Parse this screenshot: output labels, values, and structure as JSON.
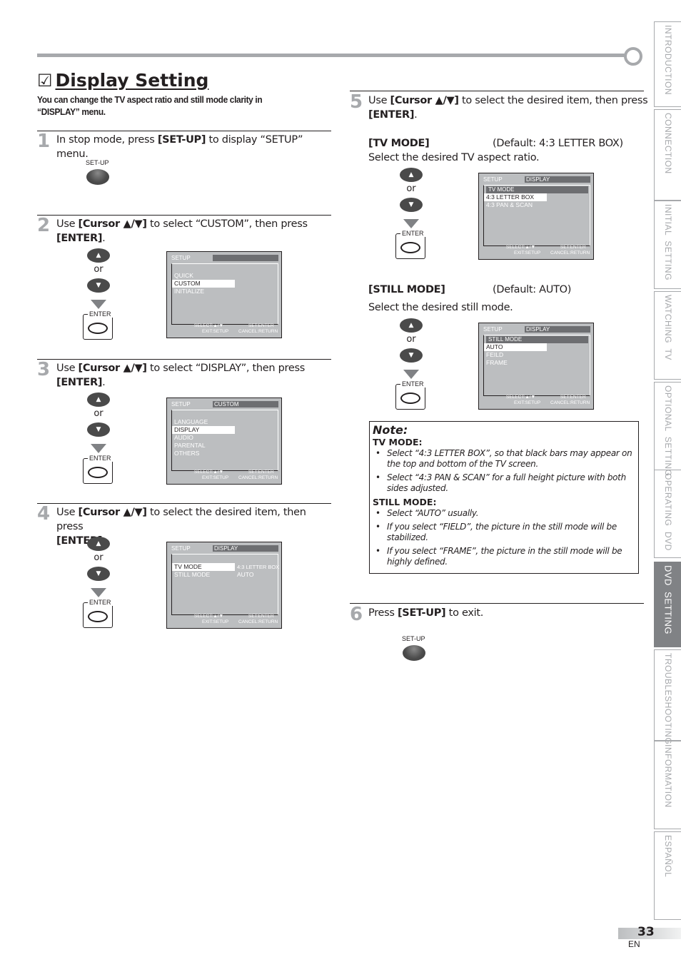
{
  "header": {
    "check_icon": "☑",
    "title": "Display Setting",
    "subtitle": "You can change the TV aspect ratio and still mode clarity in “DISPLAY” menu."
  },
  "remote": {
    "setup_label": "SET-UP",
    "up_glyph": "▲",
    "down_glyph": "▼",
    "or_label": "or",
    "enter_label": "ENTER"
  },
  "steps": [
    {
      "num": "1",
      "pre": "In stop mode, press ",
      "bold": "[SET-UP]",
      "post": " to display “SETUP” menu.",
      "line2": ""
    },
    {
      "num": "2",
      "pre": "Use ",
      "bold": "[Cursor ▲/▼]",
      "post": " to select “CUSTOM”, then press",
      "line2": "[ENTER]"
    },
    {
      "num": "3",
      "pre": "Use ",
      "bold": "[Cursor ▲/▼]",
      "post": " to select “DISPLAY”, then press",
      "line2": "[ENTER]"
    },
    {
      "num": "4",
      "pre": "Use ",
      "bold": "[Cursor ▲/▼]",
      "post": " to select the desired item, then press",
      "line2": "[ENTER]"
    },
    {
      "num": "5",
      "pre": "Use ",
      "bold": "[Cursor ▲/▼]",
      "post": " to select the desired item, then press",
      "line2": "[ENTER]"
    },
    {
      "num": "6",
      "pre": "Press ",
      "bold": "[SET-UP]",
      "post": " to exit.",
      "line2": ""
    }
  ],
  "period": ".",
  "tv_mode": {
    "label": "[TV MODE]",
    "default": "(Default: 4:3 LETTER BOX)",
    "desc": "Select the desired TV aspect ratio."
  },
  "still_mode": {
    "label": "[STILL MODE]",
    "default": "(Default: AUTO)",
    "desc": "Select the desired still mode."
  },
  "osd_footer": {
    "select": "SELECT:▲/▼",
    "exit": "EXIT:SETUP",
    "set": "SET:ENTER",
    "cancel": "CANCEL:RETURN"
  },
  "osd_screens": {
    "setup": {
      "left": "SETUP",
      "right": "",
      "items": [
        "QUICK",
        "CUSTOM",
        "INITIALIZE"
      ],
      "selected": 1
    },
    "custom": {
      "left": "SETUP",
      "right": "CUSTOM",
      "items": [
        "LANGUAGE",
        "DISPLAY",
        "AUDIO",
        "PARENTAL",
        "OTHERS"
      ],
      "selected": 1
    },
    "display": {
      "left": "SETUP",
      "right": "DISPLAY",
      "items": [
        "TV MODE",
        "STILL MODE"
      ],
      "values": [
        "4:3 LETTER BOX",
        "AUTO"
      ],
      "selected": 0
    },
    "tvmode": {
      "left": "SETUP",
      "right": "DISPLAY",
      "subhead": "TV MODE",
      "items": [
        "4:3 LETTER BOX",
        "4:3 PAN & SCAN"
      ],
      "selected": 0
    },
    "stillmode": {
      "left": "SETUP",
      "right": "DISPLAY",
      "subhead": "STILL MODE",
      "items": [
        "AUTO",
        "FEILD",
        "FRAME"
      ],
      "selected": 0
    }
  },
  "note": {
    "title": "Note:",
    "sections": [
      {
        "heading": "TV MODE:",
        "items": [
          "Select “4:3 LETTER BOX”, so that black bars may appear on the top and bottom of the TV screen.",
          "Select “4:3 PAN & SCAN” for a full height picture with both sides adjusted."
        ]
      },
      {
        "heading": "STILL MODE:",
        "items": [
          "Select “AUTO” usually.",
          "If you select “FIELD”, the picture in the still mode will be stabilized.",
          "If you select “FRAME”, the picture in the still mode will be highly defined."
        ]
      }
    ],
    "bullet": "•"
  },
  "side_tabs": [
    {
      "label": "INTRODUCTION",
      "active": false
    },
    {
      "label": "CONNECTION",
      "active": false
    },
    {
      "label": "INITIAL  SETTING",
      "active": false
    },
    {
      "label": "WATCHING  TV",
      "active": false
    },
    {
      "label": "OPTIONAL  SETTING",
      "active": false
    },
    {
      "label": "OPERATING  DVD",
      "active": false
    },
    {
      "label": "DVD  SETTING",
      "active": true
    },
    {
      "label": "TROUBLESHOOTING",
      "active": false
    },
    {
      "label": "INFORMATION",
      "active": false
    },
    {
      "label": "ESPAÑOL",
      "active": false
    }
  ],
  "footer": {
    "page_number": "33",
    "language": "EN"
  }
}
